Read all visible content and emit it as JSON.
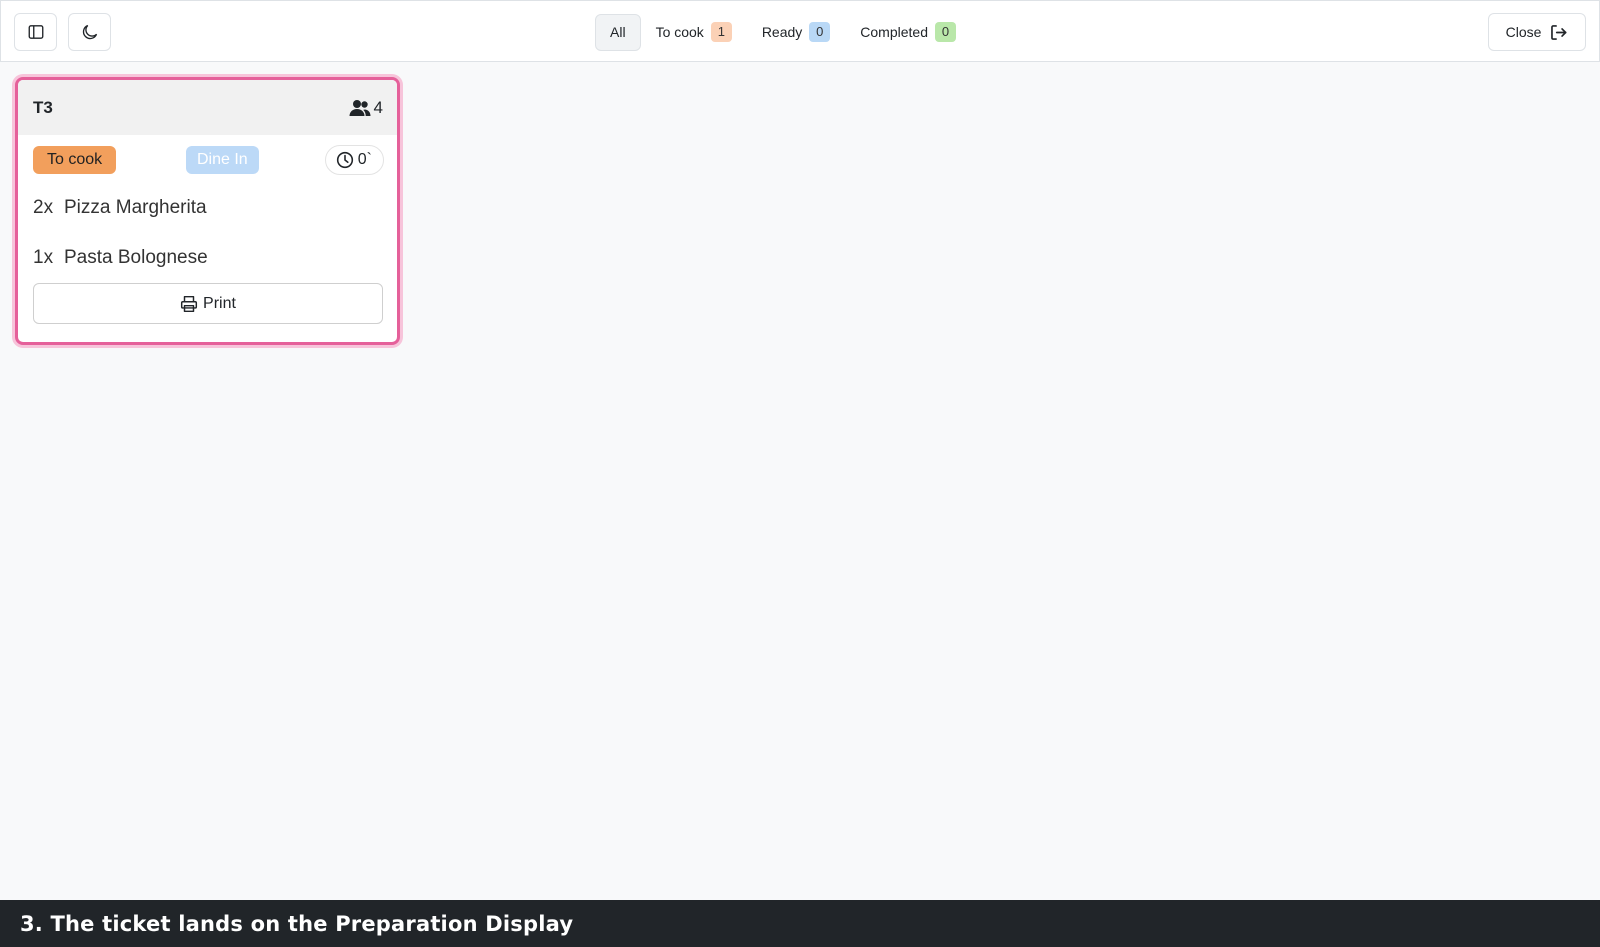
{
  "toolbar": {
    "sidebar_icon": "sidebar-toggle-icon",
    "theme_icon": "moon-icon",
    "filters": [
      {
        "label": "All",
        "count": null,
        "active": true
      },
      {
        "label": "To cook",
        "count": "1",
        "color": "#fbd1b6"
      },
      {
        "label": "Ready",
        "count": "0",
        "color": "#b9d8f6"
      },
      {
        "label": "Completed",
        "count": "0",
        "color": "#b9e7a9"
      }
    ],
    "close_label": "Close",
    "close_icon": "sign-out-icon"
  },
  "ticket": {
    "table": "T3",
    "guests": "4",
    "guests_icon": "users-icon",
    "status": "To cook",
    "status_color": "#f29f5c",
    "type": "Dine In",
    "type_color": "#bcd9f7",
    "timer": "0`",
    "timer_icon": "clock-icon",
    "border_color": "#e5609a",
    "items": [
      {
        "qty": "2x",
        "name": "Pizza Margherita"
      },
      {
        "qty": "1x",
        "name": "Pasta Bolognese"
      }
    ],
    "print_label": "Print",
    "print_icon": "printer-icon"
  },
  "caption": {
    "text": "3. The ticket lands on the Preparation Display"
  }
}
